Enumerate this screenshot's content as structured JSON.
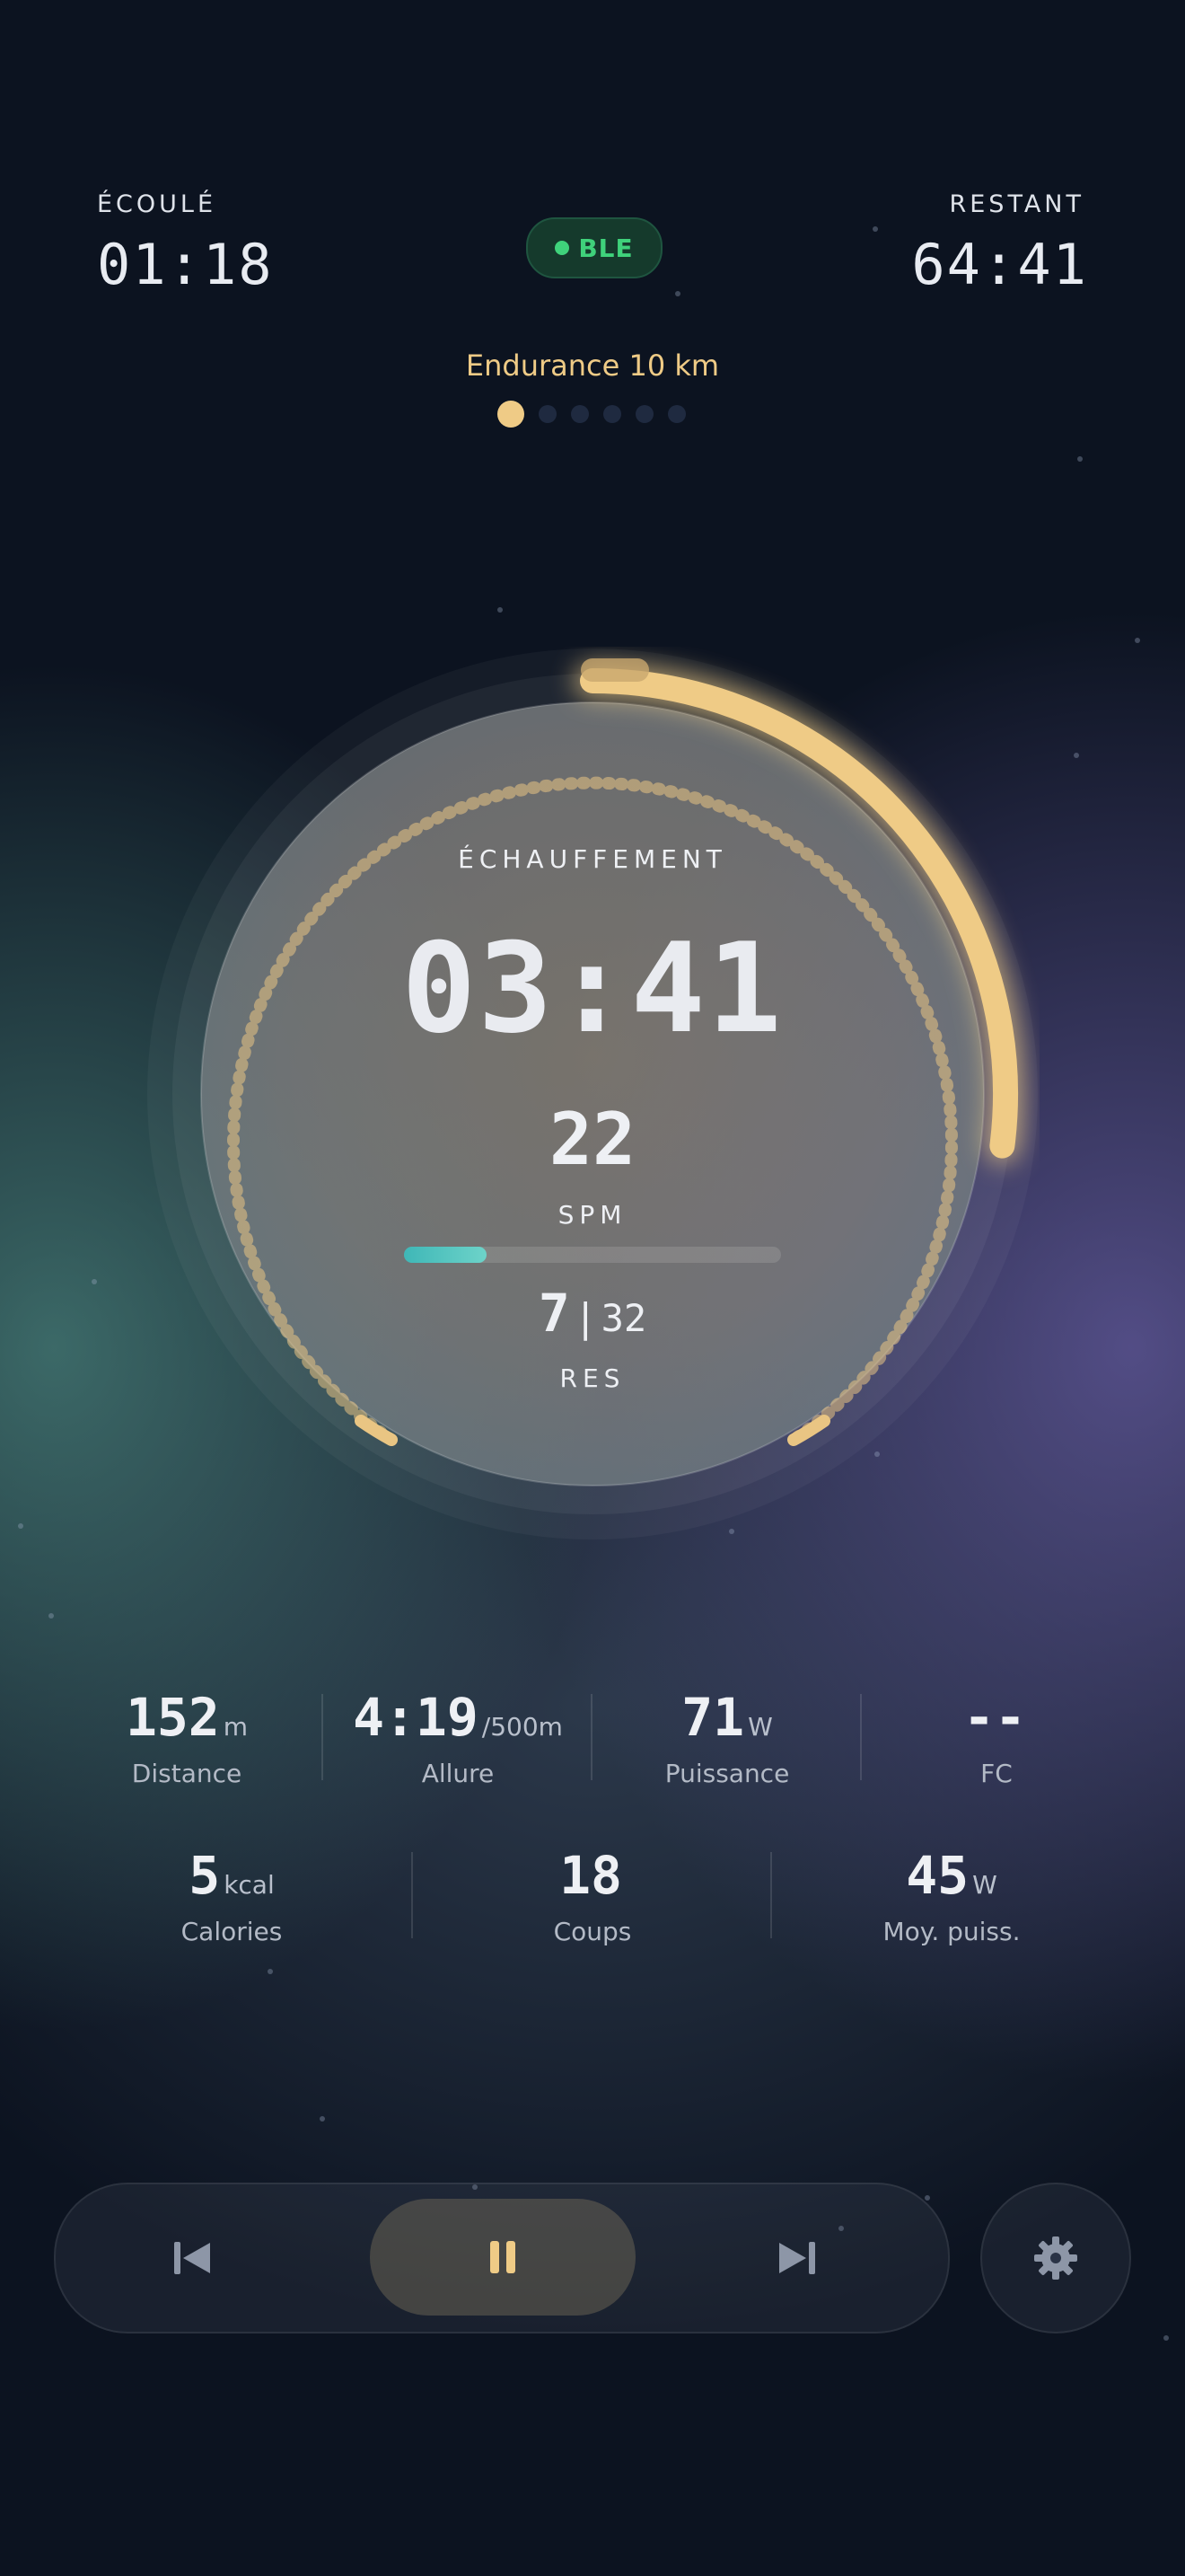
{
  "header": {
    "elapsed_label": "ÉCOULÉ",
    "elapsed_time": "01:18",
    "remaining_label": "RESTANT",
    "remaining_time": "64:41",
    "connection_badge": "BLE"
  },
  "workout": {
    "title": "Endurance 10 km",
    "segment_count": 6,
    "active_segment": 1
  },
  "ring": {
    "phase_label": "ÉCHAUFFEMENT",
    "phase_timer": "03:41",
    "spm_value": "22",
    "spm_label": "SPM",
    "spm_progress": 0.22,
    "resistance_current": "7",
    "resistance_max": "32",
    "resistance_label": "RES",
    "phase_progress": 0.27
  },
  "stats_row1": [
    {
      "value": "152",
      "unit": "m",
      "label": "Distance"
    },
    {
      "value": "4:19",
      "unit": "/500m",
      "label": "Allure"
    },
    {
      "value": "71",
      "unit": "W",
      "label": "Puissance"
    },
    {
      "value": "--",
      "unit": "",
      "label": "FC"
    }
  ],
  "stats_row2": [
    {
      "value": "5",
      "unit": "kcal",
      "label": "Calories"
    },
    {
      "value": "18",
      "unit": "",
      "label": "Coups"
    },
    {
      "value": "45",
      "unit": "W",
      "label": "Moy. puiss."
    }
  ],
  "controls": {
    "previous_icon": "skip-back-icon",
    "pause_icon": "pause-icon",
    "next_icon": "skip-forward-icon",
    "settings_icon": "gear-icon"
  },
  "colors": {
    "accent": "#efcb86",
    "ble_green": "#3fd27b",
    "spm_fill": "#3fb7b7",
    "background": "#0c1320"
  }
}
